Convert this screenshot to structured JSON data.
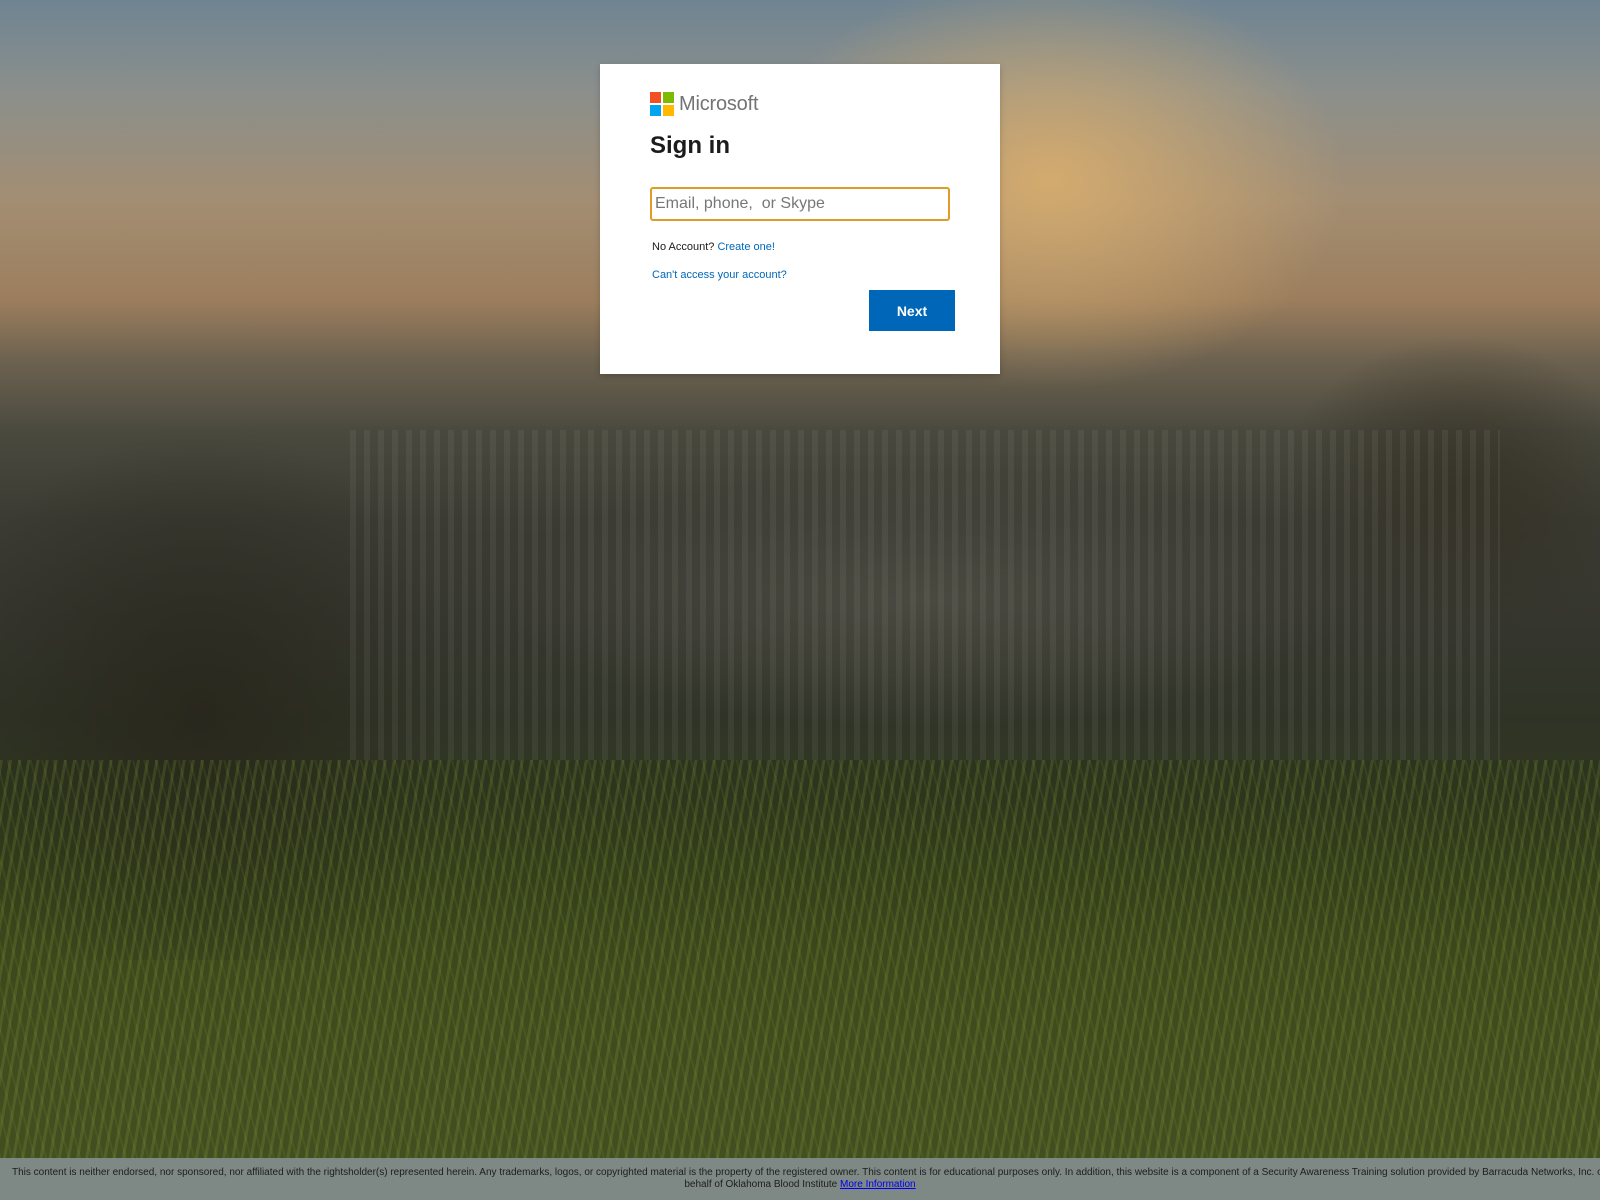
{
  "brand": {
    "name": "Microsoft",
    "logo_colors": [
      "#f25022",
      "#7fba00",
      "#00a4ef",
      "#ffb900"
    ]
  },
  "signin": {
    "title": "Sign in",
    "email_placeholder": "Email, phone,  or Skype",
    "email_value": "",
    "no_account_text": "No Account?",
    "create_link": "Create one!",
    "cant_access_link": "Can't access your account?",
    "next_label": "Next"
  },
  "footer": {
    "text_line1": "This content is neither endorsed, nor sponsored, nor affiliated with the rightsholder(s) represented herein. Any trademarks, logos, or copyrighted material is the property of the registered owner. This content is for educational purposes only. In addition, this website is a component of a Security Awareness Training solution provided by Barracuda Networks, Inc. o",
    "text_line2": "behalf of Oklahoma Blood Institute",
    "more_info_link": "More Information"
  },
  "colors": {
    "accent": "#0067b8",
    "input_focus_border": "#e09a25"
  }
}
